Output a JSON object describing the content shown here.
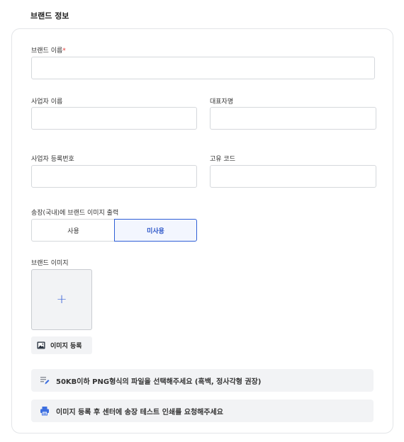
{
  "section_title": "브랜드 정보",
  "form": {
    "brand_name": {
      "label": "브랜드 이름",
      "required_mark": "*",
      "value": ""
    },
    "business_name": {
      "label": "사업자 이름",
      "value": ""
    },
    "representative": {
      "label": "대표자명",
      "value": ""
    },
    "business_reg_no": {
      "label": "사업자 등록번호",
      "value": ""
    },
    "unique_code": {
      "label": "고유 코드",
      "value": ""
    },
    "print_option": {
      "label": "송장(국내)에 브랜드 이미지 출력",
      "options": [
        "사용",
        "미사용"
      ],
      "selected": "미사용"
    },
    "brand_image": {
      "label": "브랜드 이미지",
      "add_symbol": "+",
      "register_button": "이미지 등록"
    }
  },
  "notices": [
    {
      "icon": "document-edit-icon",
      "text": "50KB이하 PNG형식의 파일을 선택해주세요 (흑백, 정사각형 권장)"
    },
    {
      "icon": "printer-icon",
      "text": "이미지 등록 후 센터에 송장 테스트 인쇄를 요청해주세요"
    }
  ],
  "colors": {
    "accent": "#2f5fd6",
    "required": "#e53935",
    "icon_blue": "#3d6fe0"
  }
}
